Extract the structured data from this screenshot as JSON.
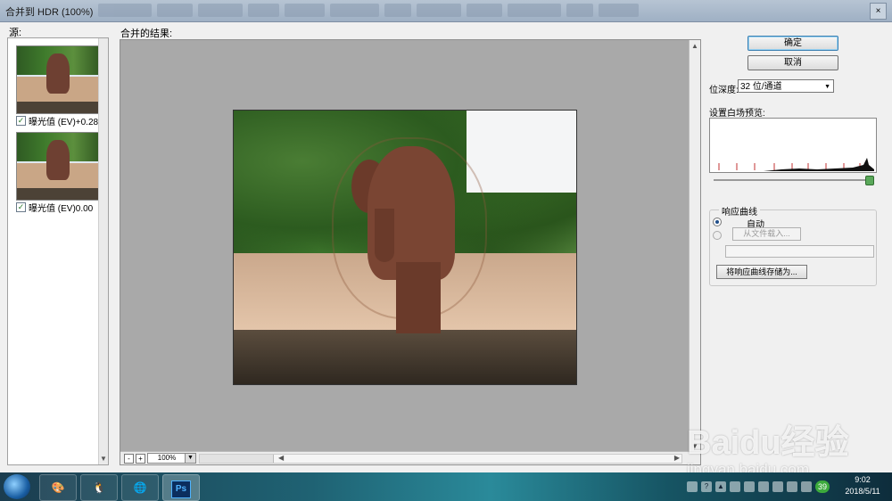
{
  "window": {
    "title": "合并到 HDR (100%)",
    "close_label": "×"
  },
  "source": {
    "label": "源:",
    "items": [
      {
        "checked": true,
        "label": "曝光值 (EV)+0.28"
      },
      {
        "checked": true,
        "label": "曝光值 (EV)0.00"
      }
    ]
  },
  "result": {
    "label": "合并的结果:",
    "zoom_value": "100%",
    "zoom_minus": "-",
    "zoom_plus": "+"
  },
  "controls": {
    "ok_label": "确定",
    "cancel_label": "取消",
    "bit_depth_label": "位深度:",
    "bit_depth_value": "32 位/通道",
    "white_point_label": "设置白场预览:",
    "white_point_level": 1.0,
    "response_curve": {
      "group_label": "响应曲线",
      "auto_label": "自动",
      "auto_selected": true,
      "load_label": "从文件载入...",
      "save_label": "将响应曲线存储为..."
    }
  },
  "watermark": {
    "brand": "Baidu经验",
    "url": "jingyan.baidu.com"
  },
  "taskbar": {
    "apps": [
      "paint",
      "qq",
      "browser",
      "photoshop"
    ],
    "ps_label": "Ps",
    "tray_badge": "39",
    "time": "9:02",
    "date": "2018/5/11"
  }
}
